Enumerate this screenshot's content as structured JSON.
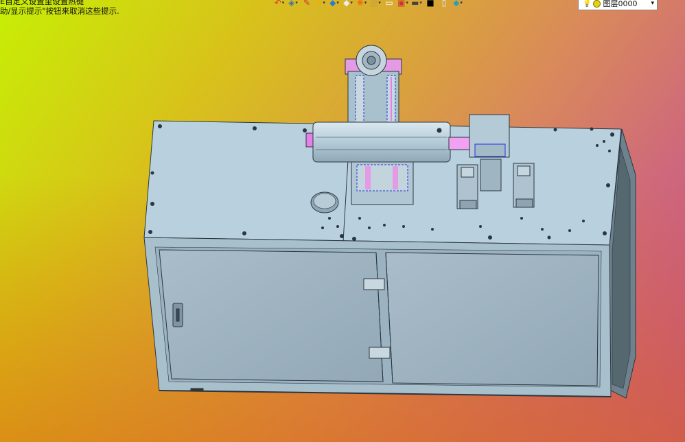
{
  "hints": {
    "line1": "E自定义设置里设置热键",
    "line2": "助/显示提示\"按钮来取消这些提示."
  },
  "toolbar": {
    "icons": [
      "undo-icon",
      "layers-icon",
      "pen-icon",
      "cube-yellow-icon",
      "cube-blue-icon",
      "box-icon",
      "sun-icon",
      "clipboard-icon",
      "page-icon",
      "frame-icon",
      "display-icon",
      "color-black-icon",
      "color-white-icon",
      "material-icon"
    ]
  },
  "layer_select": {
    "value": "图层0000",
    "icon": "bulb-icon"
  },
  "colors": {
    "panel": "#b7cfdc",
    "panel_dark": "#9cb5c3",
    "edge": "#2a3640",
    "highlight": "#e87ee8",
    "selection": "#2233dd"
  }
}
